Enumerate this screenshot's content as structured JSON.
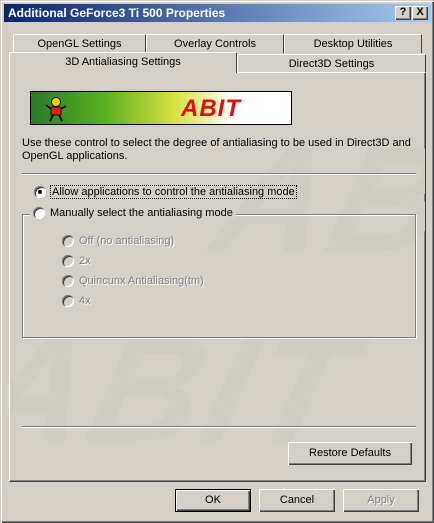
{
  "window": {
    "title": "Additional GeForce3 Ti 500 Properties",
    "help_glyph": "?",
    "close_glyph": "X"
  },
  "tabs": {
    "row1": [
      "OpenGL Settings",
      "Overlay Controls",
      "Desktop Utilities"
    ],
    "row2": [
      "3D Antialiasing Settings",
      "Direct3D Settings"
    ],
    "active": "3D Antialiasing Settings"
  },
  "banner": {
    "logo_text": "ABIT",
    "mascot_icon": "abit-mascot-icon"
  },
  "watermark": "ABIT",
  "description": "Use these control to select the degree of antialiasing to be used in Direct3D and OpenGL applications.",
  "antialiasing": {
    "allow_app_label": "Allow applications to control the antialiasing mode",
    "allow_app_selected": true,
    "manual_label": "Manually select the antialiasing mode",
    "manual_selected": false,
    "modes": [
      {
        "label": "Off (no antialiasing)",
        "enabled": false
      },
      {
        "label": "2x",
        "enabled": false
      },
      {
        "label": "Quincunx Antialiasing(tm)",
        "enabled": false
      },
      {
        "label": "4x",
        "enabled": false
      }
    ]
  },
  "buttons": {
    "restore_defaults": "Restore Defaults",
    "ok": "OK",
    "cancel": "Cancel",
    "apply": "Apply"
  },
  "colors": {
    "title_start": "#0a246a",
    "title_end": "#a6caf0",
    "face": "#d4d0c8",
    "logo_red": "#e01010"
  }
}
